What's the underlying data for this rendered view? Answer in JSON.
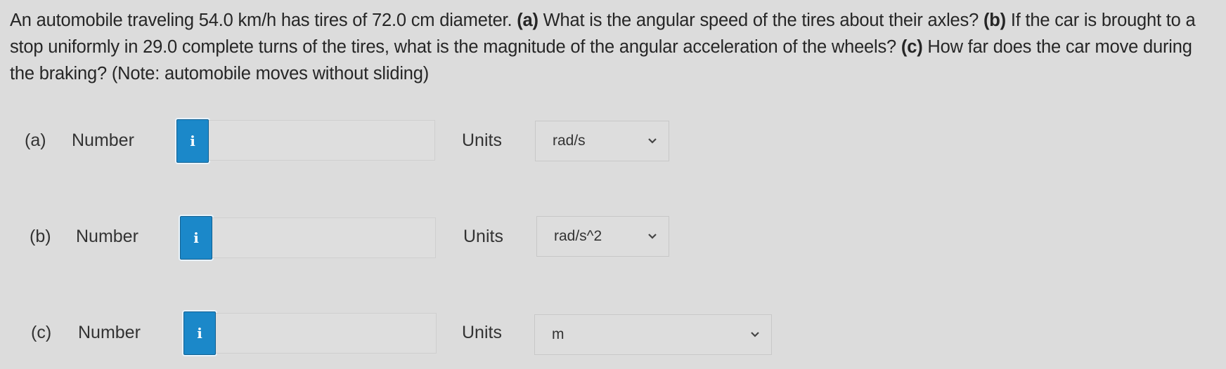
{
  "question": {
    "intro": "An automobile traveling 54.0 km/h has tires of 72.0 cm diameter. ",
    "part_a_tag": "(a)",
    "part_a_text": " What is the angular speed of the tires about their axles? ",
    "part_b_tag": "(b)",
    "part_b_text": " If the car is brought to a stop uniformly in 29.0 complete turns of the tires, what is the magnitude of the angular acceleration of the wheels? ",
    "part_c_tag": "(c)",
    "part_c_text": " How far does the car move during the braking? (Note: automobile moves without sliding)"
  },
  "answers": [
    {
      "part": "(a)",
      "number_label": "Number",
      "info_icon": "i",
      "value": "",
      "units_label": "Units",
      "units_value": "rad/s"
    },
    {
      "part": "(b)",
      "number_label": "Number",
      "info_icon": "i",
      "value": "",
      "units_label": "Units",
      "units_value": "rad/s^2"
    },
    {
      "part": "(c)",
      "number_label": "Number",
      "info_icon": "i",
      "value": "",
      "units_label": "Units",
      "units_value": "m"
    }
  ],
  "colors": {
    "info_button": "#1b88c9",
    "background": "#dcdcdc"
  }
}
